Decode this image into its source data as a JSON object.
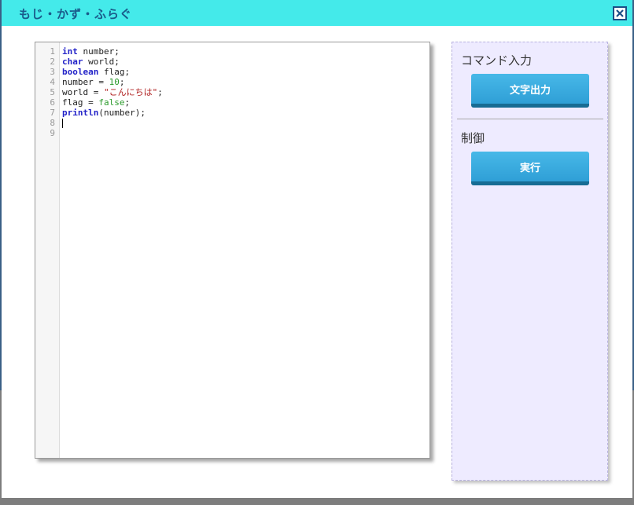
{
  "window": {
    "title": "もじ・かず・ふらぐ"
  },
  "editor": {
    "line_numbers": [
      "1",
      "2",
      "3",
      "4",
      "5",
      "6",
      "7",
      "8",
      "9"
    ],
    "lines": [
      {
        "tokens": [
          {
            "t": "int",
            "c": "kw"
          },
          {
            "t": " number;",
            "c": ""
          }
        ]
      },
      {
        "tokens": [
          {
            "t": "char",
            "c": "kw"
          },
          {
            "t": " world;",
            "c": ""
          }
        ]
      },
      {
        "tokens": [
          {
            "t": "boolean",
            "c": "kw"
          },
          {
            "t": " flag;",
            "c": ""
          }
        ]
      },
      {
        "tokens": [
          {
            "t": "number = ",
            "c": ""
          },
          {
            "t": "10",
            "c": "num"
          },
          {
            "t": ";",
            "c": ""
          }
        ]
      },
      {
        "tokens": [
          {
            "t": "world = ",
            "c": ""
          },
          {
            "t": "\"こんにちは\"",
            "c": "str"
          },
          {
            "t": ";",
            "c": ""
          }
        ]
      },
      {
        "tokens": [
          {
            "t": "flag = ",
            "c": ""
          },
          {
            "t": "false",
            "c": "bool"
          },
          {
            "t": ";",
            "c": ""
          }
        ]
      },
      {
        "tokens": [
          {
            "t": "println",
            "c": "kw"
          },
          {
            "t": "(number);",
            "c": ""
          }
        ]
      },
      {
        "tokens": [],
        "caret": true
      },
      {
        "tokens": []
      }
    ]
  },
  "panel": {
    "command_heading": "コマンド入力",
    "print_button": "文字出力",
    "control_heading": "制御",
    "run_button": "実行"
  },
  "colors": {
    "titlebar": "#44eaea",
    "title_text": "#1a5a8a",
    "keyword": "#2323c8",
    "string": "#b02020",
    "literal": "#2a9a2a",
    "button": "#2fa6dc",
    "panel_bg": "#eeebff"
  }
}
